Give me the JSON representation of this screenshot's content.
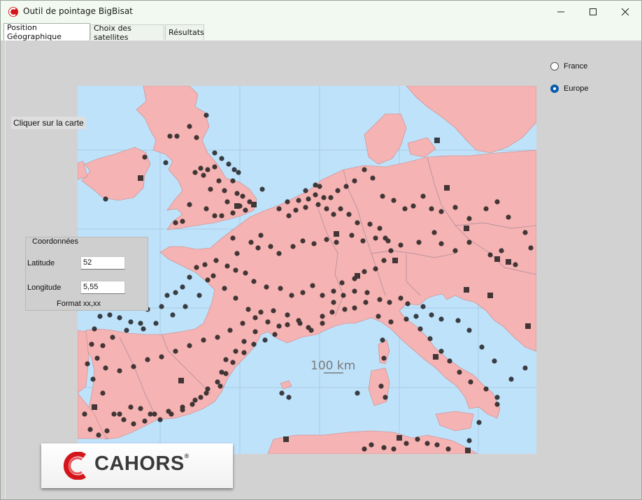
{
  "window": {
    "title": "Outil de pointage BigBisat"
  },
  "tabs": [
    {
      "label": "Position Géographique",
      "active": true
    },
    {
      "label": "Choix des satellites",
      "active": false
    },
    {
      "label": "Résultats",
      "active": false
    }
  ],
  "instruction": "Cliquer sur la carte",
  "coordinates": {
    "title": "Coordonnées",
    "latitude_label": "Latitude",
    "latitude_value": "52",
    "longitude_label": "Longitude",
    "longitude_value": "5,55",
    "format_hint": "Format xx,xx"
  },
  "region": {
    "options": [
      {
        "label": "France",
        "selected": false
      },
      {
        "label": "Europe",
        "selected": true
      }
    ]
  },
  "map": {
    "scale_label": "100 km"
  },
  "logo": {
    "text": "CAHORS",
    "mark": "®"
  },
  "colors": {
    "land": "#f5b3b3",
    "sea": "#bfe2fb",
    "marker": "#1a1a1a",
    "accent": "#0a5cad",
    "brand_red": "#d4161c"
  }
}
